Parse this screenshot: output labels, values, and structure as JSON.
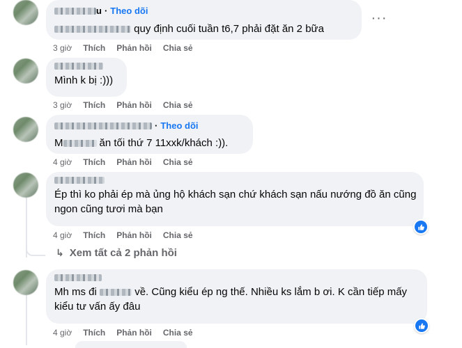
{
  "actions": {
    "like": "Thích",
    "reply": "Phản hồi",
    "share": "Chia sẻ"
  },
  "follow_label": "Theo dõi",
  "comments": [
    {
      "author_suffix": "u",
      "text": "quy định cuối tuần t6,7 phải đặt ăn 2 bữa",
      "time": "3 giờ"
    },
    {
      "text": "Mình k bị :)))",
      "time": "3 giờ"
    },
    {
      "text_prefix": "M",
      "text": "ăn tối thứ 7 11xxk/khách :)).",
      "time": "4 giờ"
    },
    {
      "text": "Ép thì ko phải ép mà ủng hộ khách sạn chứ khách sạn nấu nướng đồ ăn cũng ngon cũng tươi mà bạn",
      "time": "4 giờ"
    },
    {
      "text_a": "Mh ms đi",
      "text_b": "về. Cũng kiểu ép ng thế. Nhiều ks lắm b ơi. K cần tiếp mấy kiểu tư vấn ấy đâu",
      "time": "4 giờ"
    }
  ],
  "view_replies": "Xem tất cả 2 phản hồi",
  "icons": {
    "more": "more-horizontal-icon",
    "like_reaction": "like-thumb-icon",
    "reply_arrow": "reply-arrow-icon"
  },
  "colors": {
    "bubble": "#f0f2f5",
    "link": "#1877f2",
    "secondary": "#65676b"
  }
}
